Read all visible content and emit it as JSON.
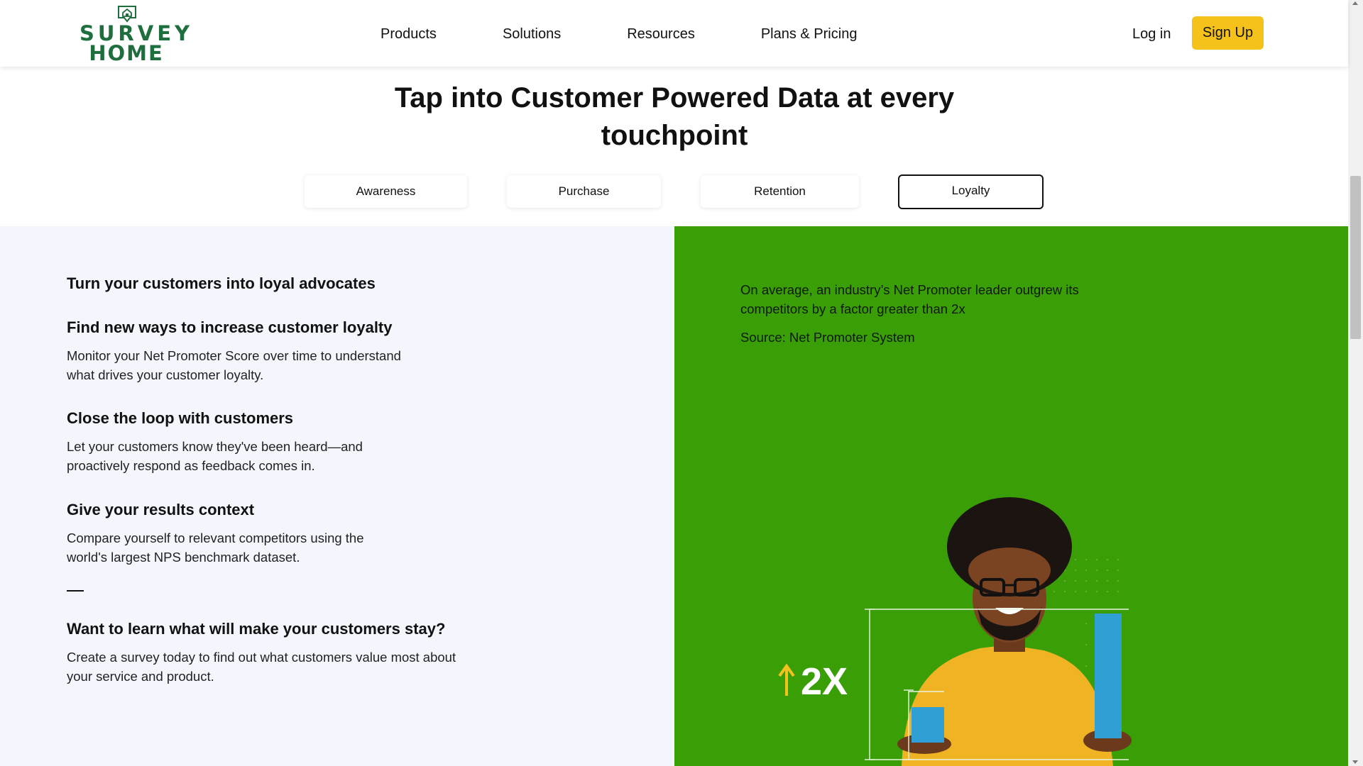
{
  "brand": {
    "logo_line1": "SURVEY",
    "logo_line2": "HOME",
    "color": "#1f6e3d"
  },
  "nav": {
    "links": [
      "Products",
      "Solutions",
      "Resources",
      "Plans & Pricing"
    ],
    "login": "Log in",
    "signup": "Sign Up",
    "signup_color": "#f5c21b"
  },
  "section": {
    "headline_line1": "Tap into Customer Powered Data at every",
    "headline_line2": "touchpoint"
  },
  "tabs": [
    {
      "label": "Awareness",
      "active": false
    },
    {
      "label": "Purchase",
      "active": false
    },
    {
      "label": "Retention",
      "active": false
    },
    {
      "label": "Loyalty",
      "active": true
    }
  ],
  "loyalty": {
    "title": "Turn your customers into loyal advocates",
    "items": [
      {
        "heading": "Find new ways to increase customer loyalty",
        "text": "Monitor your Net Promoter Score over time to understand what drives your customer loyalty."
      },
      {
        "heading": "Close the loop with customers",
        "text": "Let your customers know they've been heard—and proactively respond as feedback comes in."
      },
      {
        "heading": "Give your results context",
        "text": "Compare yourself to relevant competitors using the world's largest NPS benchmark dataset."
      }
    ],
    "cta_heading": "Want to learn what will make your customers stay?",
    "cta_text": "Create a survey today to find out what customers value most about your service and product."
  },
  "stat_panel": {
    "stat_text": "On average, an industry’s Net Promoter leader outgrew its competitors by a factor greater than 2x",
    "source": "Source: Net Promoter System",
    "badge": "2X",
    "background": "#3a9e07"
  }
}
